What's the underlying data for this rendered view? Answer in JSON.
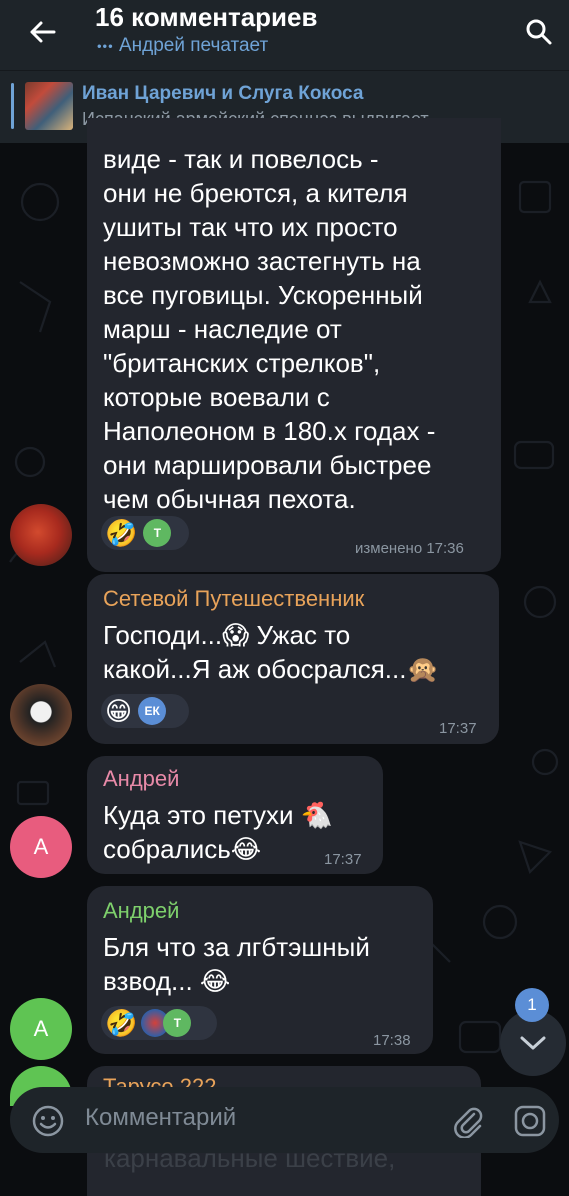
{
  "header": {
    "title": "16 комментариев",
    "typing_dots": "•••",
    "typing_status": "Андрей печатает"
  },
  "pinned": {
    "title": "Иван Царевич и Слуга Кокоса",
    "text": "Испанский армейский спецназ выдвигает…"
  },
  "messages": [
    {
      "text_lines": [
        "виде - так и повелось -",
        "они не бреются, а кителя",
        "ушиты так что их просто",
        "невозможно застегнуть на",
        "все пуговицы. Ускоренный",
        "марш - наследие от",
        "\"британских стрелков\",",
        "которые воевали с",
        "Наполеоном в 180.х годах -",
        "они маршировали быстрее",
        "чем обычная пехота."
      ],
      "reaction_emoji": "🤣",
      "reaction_initial": "Т",
      "time": "изменено 17:36"
    },
    {
      "sender": "Сетевой Путешественник",
      "line1": "Господи...😱 Ужас то",
      "line2": "какой...Я аж обосрался...🙊",
      "reaction_emoji": "😁",
      "reaction_initial": "ЕК",
      "time": "17:37"
    },
    {
      "sender": "Андрей",
      "line1": "Куда это петухи 🐔",
      "line2": "собрались😂",
      "avatar_initial": "А",
      "time": "17:37"
    },
    {
      "sender": "Андрей",
      "line1": "Бля что за лгбтэшный",
      "line2": "взвод... 😂",
      "reaction_emoji": "🤣",
      "reaction_initial": "Т",
      "avatar_initial": "А",
      "time": "17:38"
    },
    {
      "sender_partial": "Тарусе 222"
    }
  ],
  "scroll_down": {
    "unread_count": "1"
  },
  "composer": {
    "placeholder": "Комментарий"
  },
  "under_text": "карнавальные шествие,",
  "colors": {
    "accent": "#6fa3d6",
    "sender_orange": "#e8a35a",
    "sender_pink": "#e88aa8",
    "sender_green": "#7ed06c"
  }
}
